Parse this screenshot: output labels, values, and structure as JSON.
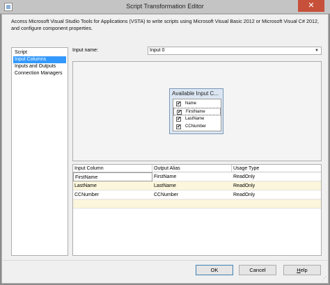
{
  "window": {
    "title": "Script Transformation Editor",
    "close_glyph": "✕"
  },
  "description": "Access Microsoft Visual Studio Tools for Applications (VSTA) to write scripts using Microsoft Visual Basic 2012 or Microsoft Visual C# 2012, and configure component properties.",
  "nav": {
    "items": [
      {
        "label": "Script",
        "selected": false
      },
      {
        "label": "Input Columns",
        "selected": true
      },
      {
        "label": "Inputs and Outputs",
        "selected": false
      },
      {
        "label": "Connection Managers",
        "selected": false
      }
    ]
  },
  "input_name": {
    "label": "Input name:",
    "value": "Input 0"
  },
  "available_columns": {
    "title": "Available Input C...",
    "columns": [
      {
        "name": "Name",
        "checked": true
      },
      {
        "name": "FirstName",
        "checked": true
      },
      {
        "name": "LastName",
        "checked": true
      },
      {
        "name": "CCNumber",
        "checked": true
      }
    ]
  },
  "grid": {
    "headers": [
      "Input Column",
      "Output Alias",
      "Usage Type"
    ],
    "rows": [
      [
        "FirstName",
        "FirstName",
        "ReadOnly"
      ],
      [
        "LastName",
        "LastName",
        "ReadOnly"
      ],
      [
        "CCNumber",
        "CCNumber",
        "ReadOnly"
      ]
    ]
  },
  "footer": {
    "ok": "OK",
    "cancel": "Cancel",
    "help_accel": "H",
    "help_rest": "elp"
  },
  "colors": {
    "selection": "#3399ff",
    "alt_row": "#fbf6dc",
    "close": "#c7503a"
  }
}
